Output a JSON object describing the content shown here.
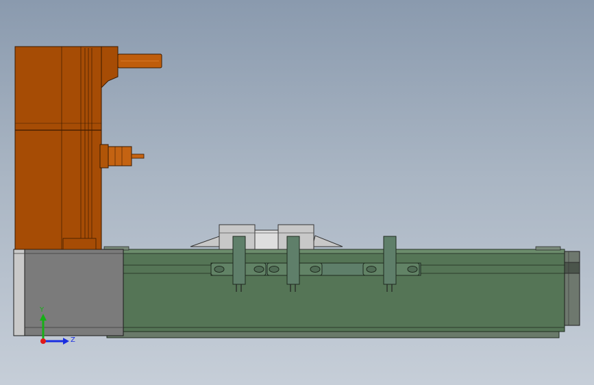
{
  "viewport": {
    "background_top": "#8a9aae",
    "background_bottom": "#c6ced8"
  },
  "model": {
    "motor_color": "#a64c05",
    "motor_outline": "#3a1a00",
    "rail_color": "#557556",
    "end_cap_color": "#7a7a7a",
    "bracket_color": "#5f7f6a",
    "carriage_color": "#c8c8c8"
  },
  "triad": {
    "y_label": "Y",
    "z_label": "Z",
    "y_color": "#16b016",
    "z_color": "#1a2ee0",
    "x_color": "#e01818"
  }
}
